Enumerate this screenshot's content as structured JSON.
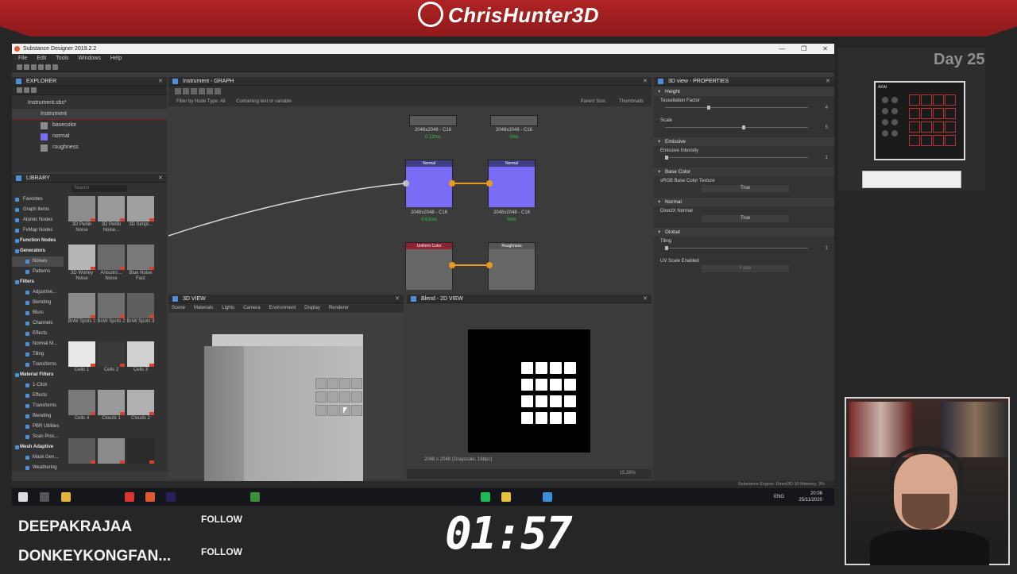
{
  "overlay": {
    "channel_title": "ChrisHunter3D",
    "day_label": "Day 25",
    "timer": "01:57",
    "follows": [
      {
        "name": "DEEPAKRAJAA",
        "action": "FOLLOW"
      },
      {
        "name": "DONKEYKONGFAN...",
        "action": "FOLLOW"
      }
    ],
    "colors": {
      "banner": "#a31f20",
      "accent": "#e79a22",
      "node_blue": "#7b6cf6"
    }
  },
  "app": {
    "window_title": "Substance Designer 2019.2.2",
    "menu": [
      "File",
      "Edit",
      "Tools",
      "Windows",
      "Help"
    ],
    "window_controls": [
      "—",
      "❐",
      "✕"
    ]
  },
  "explorer": {
    "title": "EXPLORER",
    "file": "Instrument.sbs*",
    "graph": "Instrument",
    "outputs": [
      {
        "label": "basecolor",
        "color": "#8a8a8a"
      },
      {
        "label": "normal",
        "color": "#7b6cf6"
      },
      {
        "label": "roughness",
        "color": "#8a8a8a"
      }
    ]
  },
  "library": {
    "title": "LIBRARY",
    "search_placeholder": "Search",
    "categories": [
      {
        "label": "Favorites",
        "level": 0
      },
      {
        "label": "Graph Items",
        "level": 0
      },
      {
        "label": "Atomic Nodes",
        "level": 0
      },
      {
        "label": "FxMap Nodes",
        "level": 0
      },
      {
        "label": "Function Nodes",
        "level": "hdr"
      },
      {
        "label": "Generators",
        "level": "hdr"
      },
      {
        "label": "Noises",
        "level": 1,
        "active": true
      },
      {
        "label": "Patterns",
        "level": 1
      },
      {
        "label": "Filters",
        "level": "hdr"
      },
      {
        "label": "Adjustme...",
        "level": 1
      },
      {
        "label": "Blending",
        "level": 1
      },
      {
        "label": "Blurs",
        "level": 1
      },
      {
        "label": "Channels",
        "level": 1
      },
      {
        "label": "Effects",
        "level": 1
      },
      {
        "label": "Normal M...",
        "level": 1
      },
      {
        "label": "Tiling",
        "level": 1
      },
      {
        "label": "Transforms",
        "level": 1
      },
      {
        "label": "Material Filters",
        "level": "hdr"
      },
      {
        "label": "1-Click",
        "level": 1
      },
      {
        "label": "Effects",
        "level": 1
      },
      {
        "label": "Transforms",
        "level": 1
      },
      {
        "label": "Blending",
        "level": 1
      },
      {
        "label": "PBR Utilities",
        "level": 1
      },
      {
        "label": "Scan Proc...",
        "level": 1
      },
      {
        "label": "Mesh Adaptive",
        "level": "hdr"
      },
      {
        "label": "Mask Gen...",
        "level": 1
      },
      {
        "label": "Weathering",
        "level": 1
      }
    ],
    "thumbs": [
      {
        "label": "3D Perlin Noise",
        "tone": "#8c8c8c"
      },
      {
        "label": "3D Perlin Noise...",
        "tone": "#9a9a9a"
      },
      {
        "label": "3D Simpl...",
        "tone": "#a0a0a0"
      },
      {
        "label": "3D Worley Noise",
        "tone": "#b5b5b5"
      },
      {
        "label": "Anisotro... Noise",
        "tone": "#6a6a6a"
      },
      {
        "label": "Blue Noise Fast",
        "tone": "#7a7a7a"
      },
      {
        "label": "BnW Spots 1",
        "tone": "#8a8a8a"
      },
      {
        "label": "BnW Spots 2",
        "tone": "#6f6f6f"
      },
      {
        "label": "BnW Spots 3",
        "tone": "#5f5f5f"
      },
      {
        "label": "Cells 1",
        "tone": "#e8e8e8"
      },
      {
        "label": "Cells 2",
        "tone": "#3a3a3a"
      },
      {
        "label": "Cells 3",
        "tone": "#d0d0d0"
      },
      {
        "label": "Cells 4",
        "tone": "#7a7a7a"
      },
      {
        "label": "Clouds 1",
        "tone": "#9a9a9a"
      },
      {
        "label": "Clouds 2",
        "tone": "#b0b0b0"
      },
      {
        "label": "",
        "tone": "#5a5a5a"
      },
      {
        "label": "",
        "tone": "#8a8a8a"
      },
      {
        "label": "",
        "tone": "#2a2a2a"
      }
    ]
  },
  "graph": {
    "title": "Instrument - GRAPH",
    "filter_label": "Filter by Node Type: All",
    "containing_label": "Containing text or variable",
    "parent_size": "Parent Size:",
    "thumbnails": "Thumbnails",
    "nodes": [
      {
        "title": "Normal",
        "res": "2048x2048 - C16",
        "time": "0.61ms"
      },
      {
        "title": "Normal",
        "res": "2048x2048 - C16",
        "time": "0ms"
      },
      {
        "title": "Uniform Color",
        "res": "",
        "time": ""
      },
      {
        "title": "Roughness",
        "res": "",
        "time": ""
      }
    ],
    "top_nodes": [
      {
        "res": "2048x2048 - C16",
        "time": "0.12ms"
      },
      {
        "res": "2048x2048 - C16",
        "time": "0ms"
      }
    ]
  },
  "properties": {
    "title": "3D view - PROPERTIES",
    "sections": [
      {
        "name": "Height",
        "rows": [
          {
            "label": "Tessellation Factor",
            "type": "slider",
            "value": "4",
            "pos": 0.3
          },
          {
            "label": "Scale",
            "type": "slider",
            "value": "5",
            "pos": 0.55
          }
        ]
      },
      {
        "name": "Emissive",
        "rows": [
          {
            "label": "Emissive Intensity",
            "type": "slider",
            "value": "1",
            "pos": 0.0
          }
        ]
      },
      {
        "name": "Base Color",
        "rows": [
          {
            "label": "sRGB Base Color Texture",
            "type": "bool",
            "value": "True",
            "dim": false
          }
        ]
      },
      {
        "name": "Normal",
        "rows": [
          {
            "label": "DirectX Normal",
            "type": "bool",
            "value": "True",
            "dim": false
          }
        ]
      },
      {
        "name": "Global",
        "rows": [
          {
            "label": "Tiling",
            "type": "slider",
            "value": "1",
            "pos": 0.0
          },
          {
            "label": "UV Scale Enabled",
            "type": "bool",
            "value": "False",
            "dim": true
          }
        ]
      }
    ]
  },
  "view3d": {
    "title": "3D VIEW",
    "menus": [
      "Scene",
      "Materials",
      "Lights",
      "Camera",
      "Environment",
      "Display",
      "Renderer"
    ]
  },
  "view2d": {
    "title": "Blend - 2D VIEW",
    "info": "2048 x 2048 (Grayscale, 16bpc)",
    "zoom": "15.38%"
  },
  "status": {
    "engine": "Substance Engine: Direct3D 10  Memory: 3%"
  },
  "taskbar": {
    "time": "20:06",
    "date": "25/11/2020",
    "lang": "ENG"
  }
}
